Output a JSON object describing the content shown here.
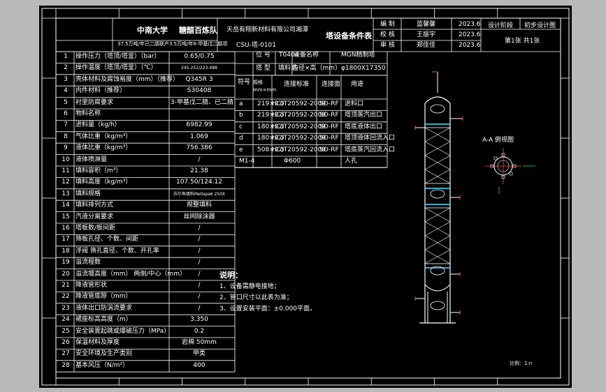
{
  "title_block": {
    "school": "中南大学",
    "team": "糖醋百炼队",
    "company": "天岳有翔新材料有限公司湘潭",
    "doc_title": "塔设备条件表",
    "subtitle": "37.5万吨/年已二腈联产3.5万吨/年6-甲基戊二腈项",
    "drawing_no": "CSU-塔-0101",
    "roles": [
      {
        "role": "编 制",
        "name": "蓝馨馨",
        "date": "2023.6"
      },
      {
        "role": "校 核",
        "name": "王振宇",
        "date": "2023.6"
      },
      {
        "role": "审 核",
        "name": "郑佳佳",
        "date": "2023.6"
      }
    ],
    "stage_label": "设计阶段",
    "stage_value": "初步设计图",
    "sheet_info": "第1张 共1张"
  },
  "params": [
    {
      "no": "1",
      "label": "操作压力（塔顶/塔釜）（bar）",
      "value": "0.65/0.75"
    },
    {
      "no": "2",
      "label": "操作温度（塔顶/塔釜）（℃）",
      "value": "245.251/223.488"
    },
    {
      "no": "3",
      "label": "壳体材料及腐蚀裕度（mm）（推荐）",
      "value": "Q345R 3"
    },
    {
      "no": "4",
      "label": "内件材料（推荐）",
      "value": "S30408"
    },
    {
      "no": "5",
      "label": "衬里防腐要求",
      "value": "3-甲基戊二腈、已二腈"
    },
    {
      "no": "6",
      "label": "物料名称",
      "value": ""
    },
    {
      "no": "7",
      "label": "进料量（kg/h）",
      "value": "6982.99"
    },
    {
      "no": "8",
      "label": "气体比重（kg/m³）",
      "value": "1.069"
    },
    {
      "no": "9",
      "label": "液体比重（kg/m³）",
      "value": "756.386"
    },
    {
      "no": "10",
      "label": "液体喷淋量",
      "value": "/"
    },
    {
      "no": "11",
      "label": "填料容积（m³）",
      "value": "21.38"
    },
    {
      "no": "12",
      "label": "填料高度（kg/m³）",
      "value": "107.50/124.12"
    },
    {
      "no": "13",
      "label": "填料规格",
      "value": "苏尔寿填料Mellapak 250X"
    },
    {
      "no": "14",
      "label": "填料排列方式",
      "value": "规整填料"
    },
    {
      "no": "15",
      "label": "汽液分离要求",
      "value": "丝网除沫器"
    },
    {
      "no": "16",
      "label": "塔板数/板间距",
      "value": "/"
    },
    {
      "no": "17",
      "label": "筛板孔径、个数、间距",
      "value": "/"
    },
    {
      "no": "18",
      "label": "浮阀 筛孔直径、个数、开孔率",
      "value": "/"
    },
    {
      "no": "19",
      "label": "溢流程数",
      "value": "/"
    },
    {
      "no": "20",
      "label": "溢流堰高度（mm） 两侧/中心（mm）",
      "value": "/"
    },
    {
      "no": "21",
      "label": "降液管形状",
      "value": "/"
    },
    {
      "no": "22",
      "label": "降液管底隙（mm）",
      "value": "/"
    },
    {
      "no": "23",
      "label": "液体出口防涡流要求",
      "value": "/"
    },
    {
      "no": "24",
      "label": "裙座标高高度（m）",
      "value": "3.350"
    },
    {
      "no": "25",
      "label": "安全装置起跳或爆破压力（MPa）",
      "value": "0.2"
    },
    {
      "no": "26",
      "label": "保温材料及厚度",
      "value": "岩棉 50mm"
    },
    {
      "no": "27",
      "label": "安全环境及生产类别",
      "value": "甲类"
    },
    {
      "no": "28",
      "label": "基本风压（N/m²）",
      "value": "400"
    }
  ],
  "equipment": {
    "pos_label": "位 号",
    "pos_value": "T0404",
    "name_label": "设备名称",
    "name_value": "MGN精制塔",
    "type_label": "塔 型",
    "type_value": "填料塔",
    "dia_label": "内径×高（mm）",
    "dia_value": "φ1800X17350"
  },
  "nozzles": {
    "headers": [
      "符号",
      "规格 mm×mm",
      "连接标准",
      "连接面",
      "用途"
    ],
    "rows": [
      {
        "id": "a",
        "size": "219×2.5",
        "std": "HG/T20592-2009",
        "face": "SO-RF",
        "use": "进料口"
      },
      {
        "id": "b",
        "size": "219×2.5",
        "std": "HG/T20592-2009",
        "face": "SO-RF",
        "use": "塔顶蒸汽出口"
      },
      {
        "id": "c",
        "size": "180×2.5",
        "std": "HG/T20592-2009",
        "face": "SO-RF",
        "use": "塔底液体出口"
      },
      {
        "id": "d",
        "size": "180×2.5",
        "std": "HG/T20592-2009",
        "face": "SO-RF",
        "use": "塔顶液体回流入口"
      },
      {
        "id": "e",
        "size": "508×2.5",
        "std": "HG/T20592-2009",
        "face": "SO-RF",
        "use": "塔底蒸汽回流入口"
      },
      {
        "id": "M1-4",
        "size": "",
        "std": "Φ600",
        "face": "",
        "use": "人孔"
      }
    ]
  },
  "notes": {
    "heading": "说明：",
    "items": [
      "1、设备需静电接地；",
      "2、管口尺寸以此表为准；",
      "3、设置安装平面：±0.000平面。"
    ]
  },
  "drawing": {
    "section_title": "A-A 俯视图",
    "labels": [
      "A",
      "A"
    ],
    "scale_note": "比例：1:n"
  }
}
